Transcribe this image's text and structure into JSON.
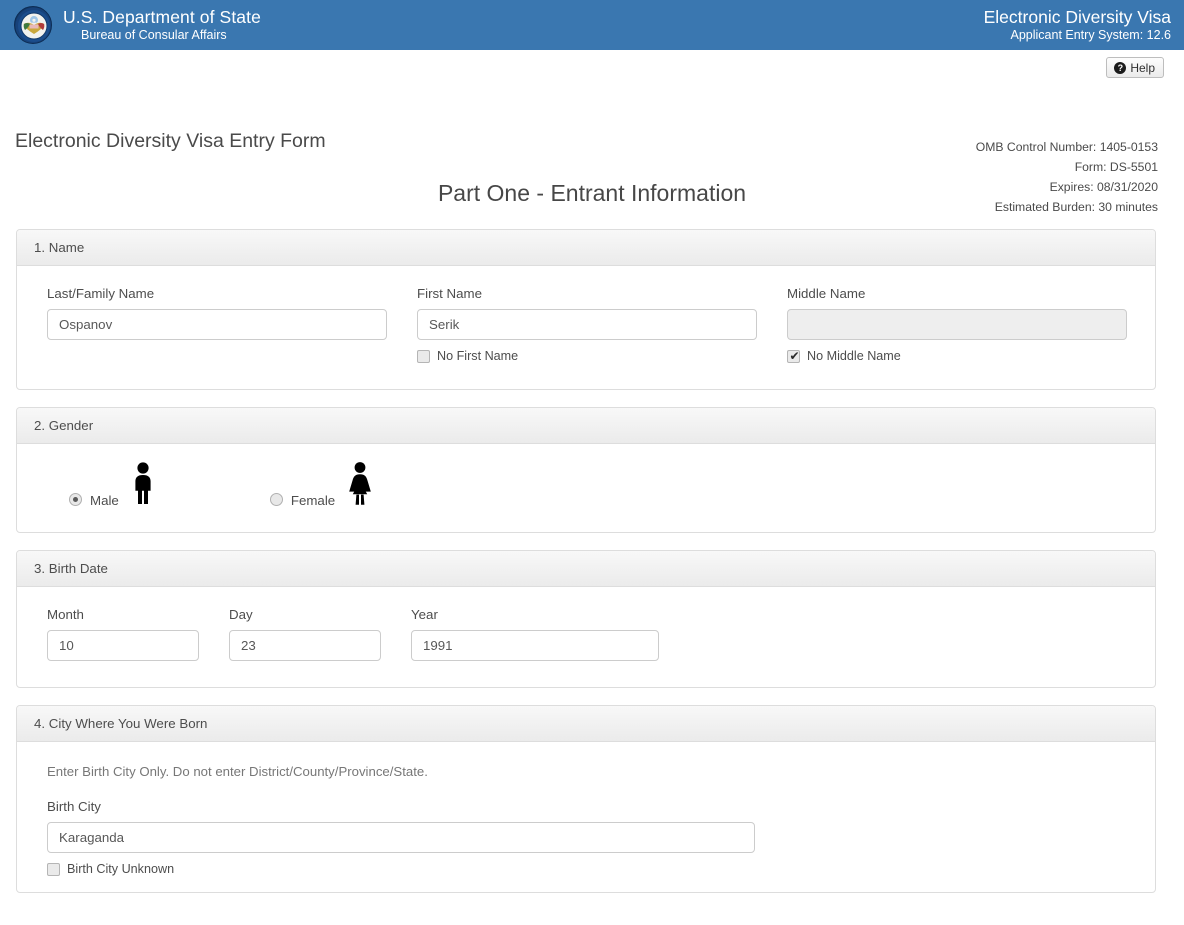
{
  "banner": {
    "seal_alt": "us-department-of-state-seal",
    "agency_line1": "U.S. Department of State",
    "agency_line2": "Bureau of Consular Affairs",
    "app_line1": "Electronic Diversity Visa",
    "app_line2": "Applicant Entry System: 12.6",
    "background_color": "#3a77b0"
  },
  "toolbar": {
    "help_label": "Help",
    "help_icon": "question-circle-icon"
  },
  "page": {
    "title": "Electronic Diversity Visa Entry Form",
    "meta": {
      "omb": "OMB Control Number: 1405-0153",
      "form": "Form: DS-5501",
      "expires": "Expires: 08/31/2020",
      "burden": "Estimated Burden: 30 minutes"
    },
    "part_title": "Part One - Entrant Information"
  },
  "sections": {
    "name": {
      "heading": "1. Name",
      "last_label": "Last/Family Name",
      "last_value": "Ospanov",
      "first_label": "First Name",
      "first_value": "Serik",
      "first_checkbox_label": "No First Name",
      "first_checkbox_checked": false,
      "middle_label": "Middle Name",
      "middle_value": "",
      "middle_checkbox_label": "No Middle Name",
      "middle_checkbox_checked": true
    },
    "gender": {
      "heading": "2. Gender",
      "male_label": "Male",
      "male_selected": true,
      "female_label": "Female",
      "female_selected": false,
      "male_icon": "male-figure-icon",
      "female_icon": "female-figure-icon"
    },
    "birth_date": {
      "heading": "3. Birth Date",
      "month_label": "Month",
      "month_value": "10",
      "day_label": "Day",
      "day_value": "23",
      "year_label": "Year",
      "year_value": "1991"
    },
    "birth_city": {
      "heading": "4. City Where You Were Born",
      "hint": "Enter Birth City Only. Do not enter District/County/Province/State.",
      "city_label": "Birth City",
      "city_value": "Karaganda",
      "unknown_checkbox_label": "Birth City Unknown",
      "unknown_checkbox_checked": false
    }
  }
}
